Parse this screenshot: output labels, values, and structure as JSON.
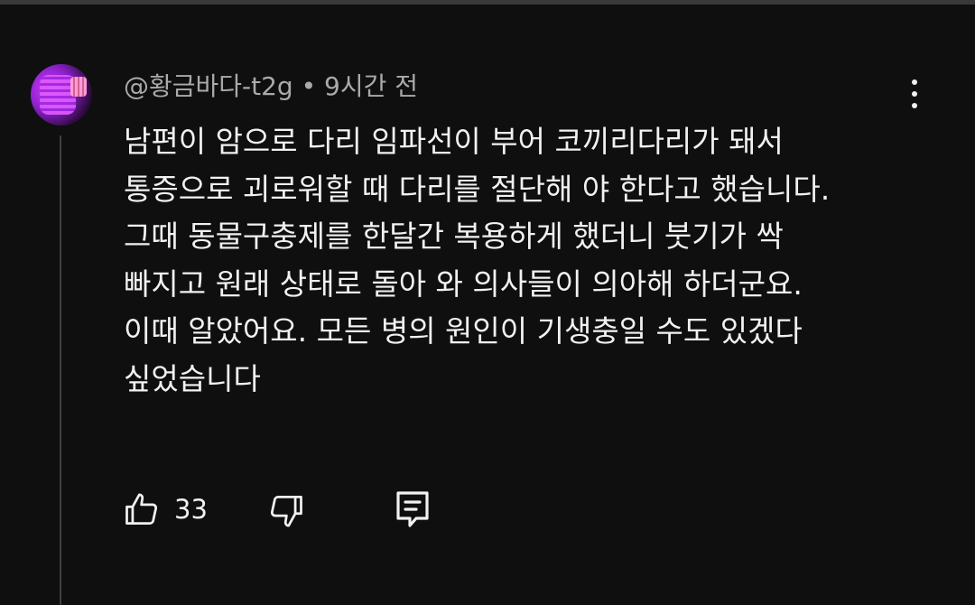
{
  "comment": {
    "author": "@황금바다-t2g",
    "separator": "•",
    "time_ago": "9시간 전",
    "text_lines": [
      "남편이 암으로 다리 임파선이 부어 코끼리다리가 돼서",
      "통증으로 괴로워할 때 다리를 절단해 야 한다고 했습니다.",
      "그때 동물구충제를 한달간 복용하게 했더니 붓기가 싹",
      "빠지고 원래 상태로 돌아 와 의사들이 의아해 하더군요.",
      "이때 알았어요.  모든 병의 원인이 기생충일 수도 있겠다",
      "싶었습니다"
    ],
    "like_count": "33"
  },
  "icons": {
    "more": "more-vert-icon",
    "like": "thumb-up-icon",
    "dislike": "thumb-down-icon",
    "reply": "comment-reply-icon"
  },
  "colors": {
    "background": "#0f0f0f",
    "text_primary": "#f1f1f1",
    "text_secondary": "#aaaaaa",
    "thread_line": "#3f3f3f"
  }
}
